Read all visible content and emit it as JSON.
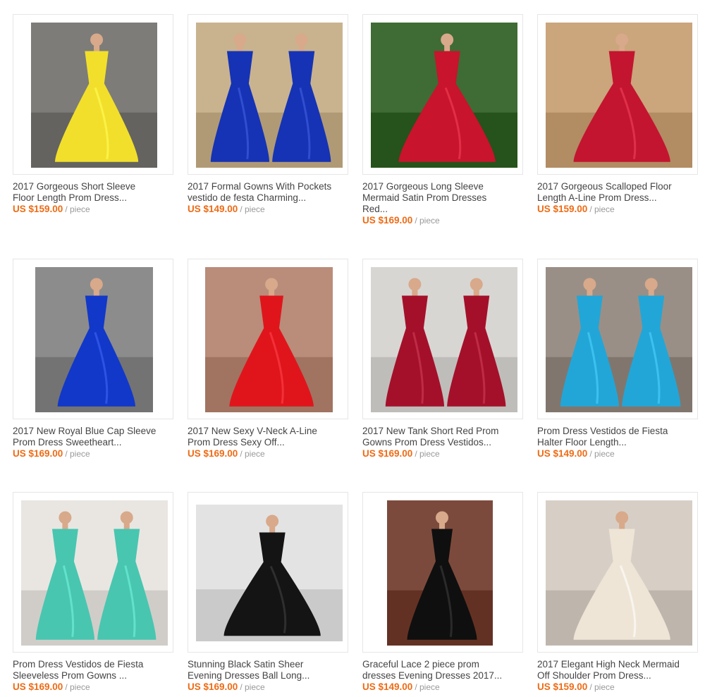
{
  "products": [
    {
      "title": "2017 Gorgeous Short Sleeve\nFloor Length Prom Dress...",
      "price": "US $159.00",
      "unit": "/ piece",
      "dress_color": "#f2df2b",
      "bg_color": "#7d7c79"
    },
    {
      "title": "2017 Formal Gowns With Pockets\nvestido de festa Charming...",
      "price": "US $149.00",
      "unit": "/ piece",
      "dress_color": "#1533b4",
      "bg_color": "#c9b38f"
    },
    {
      "title": "2017 Gorgeous Long Sleeve\nMermaid Satin Prom Dresses\nRed...",
      "price": "US $169.00",
      "unit": "/ piece",
      "dress_color": "#c8142c",
      "bg_color": "#3f6b34"
    },
    {
      "title": "2017 Gorgeous Scalloped Floor\nLength A-Line Prom Dress...",
      "price": "US $159.00",
      "unit": "/ piece",
      "dress_color": "#c3152f",
      "bg_color": "#cba57c"
    },
    {
      "title": "2017 New Royal Blue Cap Sleeve\nProm Dress Sweetheart...",
      "price": "US $169.00",
      "unit": "/ piece",
      "dress_color": "#1238c9",
      "bg_color": "#8c8c8c"
    },
    {
      "title": "2017 New Sexy V-Neck A-Line\nProm Dress Sexy Off...",
      "price": "US $169.00",
      "unit": "/ piece",
      "dress_color": "#e0151c",
      "bg_color": "#b98d7a"
    },
    {
      "title": "2017 New Tank Short Red Prom\nGowns Prom Dress Vestidos...",
      "price": "US $169.00",
      "unit": "/ piece",
      "dress_color": "#a4102a",
      "bg_color": "#d8d6d3"
    },
    {
      "title": "Prom Dress Vestidos de Fiesta\nHalter Floor Length...",
      "price": "US $149.00",
      "unit": "/ piece",
      "dress_color": "#22a6d8",
      "bg_color": "#9a8f86"
    },
    {
      "title": "Prom Dress Vestidos de Fiesta\nSleeveless Prom Gowns ...",
      "price": "US $169.00",
      "unit": "/ piece",
      "dress_color": "#48c6b0",
      "bg_color": "#e9e6e2"
    },
    {
      "title": "Stunning Black Satin Sheer\nEvening Dresses Ball Long...",
      "price": "US $169.00",
      "unit": "/ piece",
      "dress_color": "#141414",
      "bg_color": "#e3e3e3"
    },
    {
      "title": "Graceful Lace 2 piece prom\ndresses Evening Dresses 2017...",
      "price": "US $149.00",
      "unit": "/ piece",
      "dress_color": "#0f0f0f",
      "bg_color": "#7c4a3c"
    },
    {
      "title": "2017 Elegant High Neck Mermaid\nOff Shoulder Prom Dress...",
      "price": "US $159.00",
      "unit": "/ piece",
      "dress_color": "#eee5d6",
      "bg_color": "#d7cfc6"
    }
  ]
}
